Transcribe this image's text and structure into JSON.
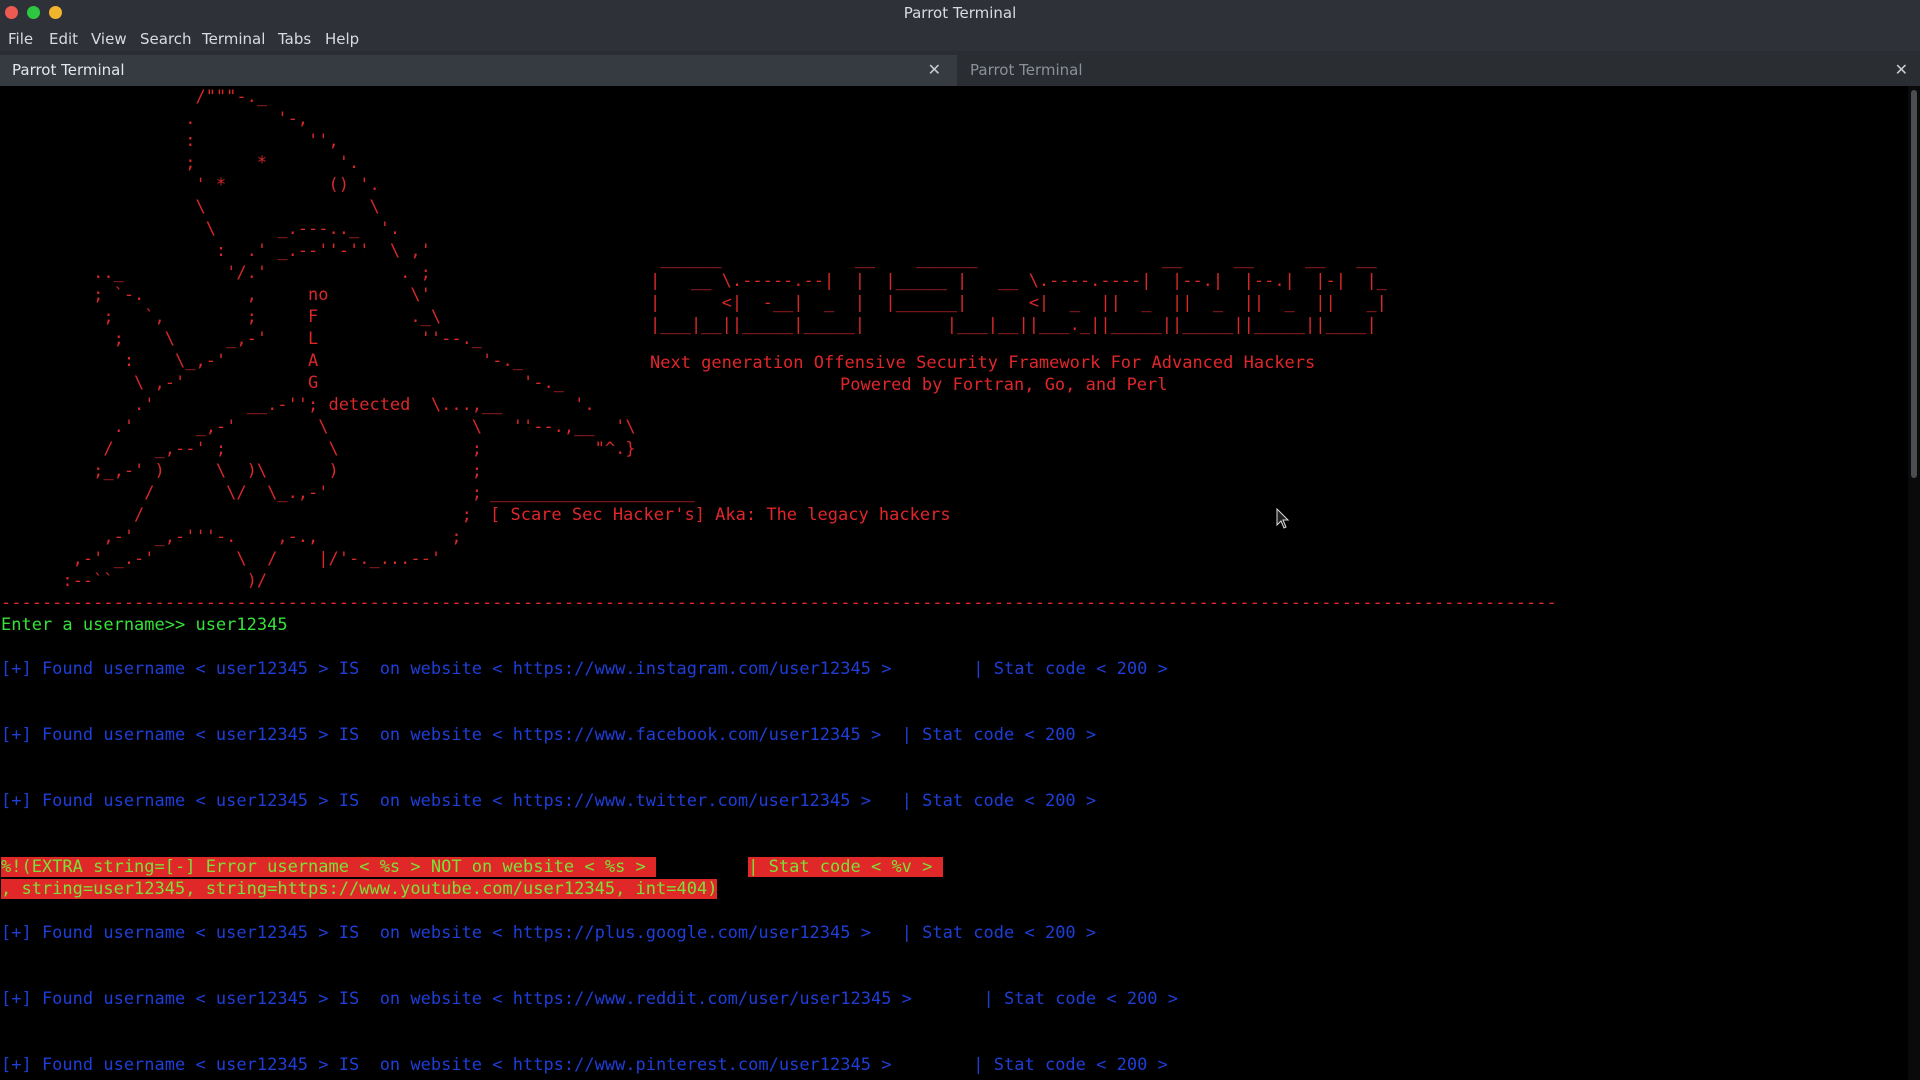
{
  "window": {
    "title": "Parrot Terminal"
  },
  "menu": [
    "File",
    "Edit",
    "View",
    "Search",
    "Terminal",
    "Tabs",
    "Help"
  ],
  "tabs": [
    {
      "label": "Parrot Terminal",
      "active": true
    },
    {
      "label": "Parrot Terminal",
      "active": false
    }
  ],
  "ascii_art": "                   /\"\"\"-._\n                  .        '-,\n                  :           '',\n                  ;      *       '.\n                   ' *          () '.\n                   \\                \\\n                    \\      _.---.._  '.\n                     :  .' _.--''-''  \\ ,'\n         .._          '/.'             . ;\n         ; `-.          ,     no        \\'\n          ;   `,        ;     F         ._\\\n           ;    \\     _,-'    L          ''--._\n            :    \\_,-'        A                '-._\n             \\ ,-'            G                    '-._\n             .'         __.-''; detected  \\...,__       '.\n           .'      _,-'        \\              \\   ''--.,__  '\\\n          /    _,--' ;          \\             ;           \"^.}\n         ;_,-' )     \\  )\\      )             ;\n              /       \\/  \\_.,-'              ;\n             /                               ;\n          ,-'  _,-'''-.    ,-.,             ;\n       ,-' _.-'        \\  /    |/'-._...--'\n      :--``             )/",
  "banner": {
    "art": " ______             __    ______                  __     __     __   __ \n|   __ \\.-----.--|  |  |_____ |   __ \\.----.----|  |--.|  |--.|  |-|  |_\n|      <|  -__|  _  |  |______|      <|  _  ||  _  ||  _  ||  _  ||   _|\n|___|__||_____|_____|        |___|__||___._||_____||_____||_____||____|",
    "subtitle1": "Next generation Offensive Security Framework For Advanced Hackers",
    "subtitle2": "Powered by Fortran, Go, and Perl"
  },
  "scare": {
    "dash": "____________________",
    "text": "[ Scare Sec Hacker's] Aka: The legacy hackers"
  },
  "separator": "--------------------------------------------------------------------------------------------------------------------------------------------------------",
  "prompt": "Enter a username>> user12345",
  "results": [
    "[+] Found username < user12345 > IS  on website < https://www.instagram.com/user12345 >        | Stat code < 200 >",
    "[+] Found username < user12345 > IS  on website < https://www.facebook.com/user12345 >  | Stat code < 200 >",
    "[+] Found username < user12345 > IS  on website < https://www.twitter.com/user12345 >   | Stat code < 200 >",
    "[+] Found username < user12345 > IS  on website < https://plus.google.com/user12345 >   | Stat code < 200 >",
    "[+] Found username < user12345 > IS  on website < https://www.reddit.com/user/user12345 >       | Stat code < 200 >",
    "[+] Found username < user12345 > IS  on website < https://www.pinterest.com/user12345 >        | Stat code < 200 >"
  ],
  "error": {
    "line1a": "%!(EXTRA string=[-] Error username < %s > NOT on website < %s > ",
    "line1b": "| Stat code < %v > ",
    "line2": ", string=user12345, string=https://www.youtube.com/user12345, int=404)"
  },
  "colors": {
    "ascii": "#d82828",
    "prompt": "#36e13a",
    "found": "#1f3ed8",
    "error_bg": "#e02828",
    "error_fg": "#7ce03a"
  }
}
